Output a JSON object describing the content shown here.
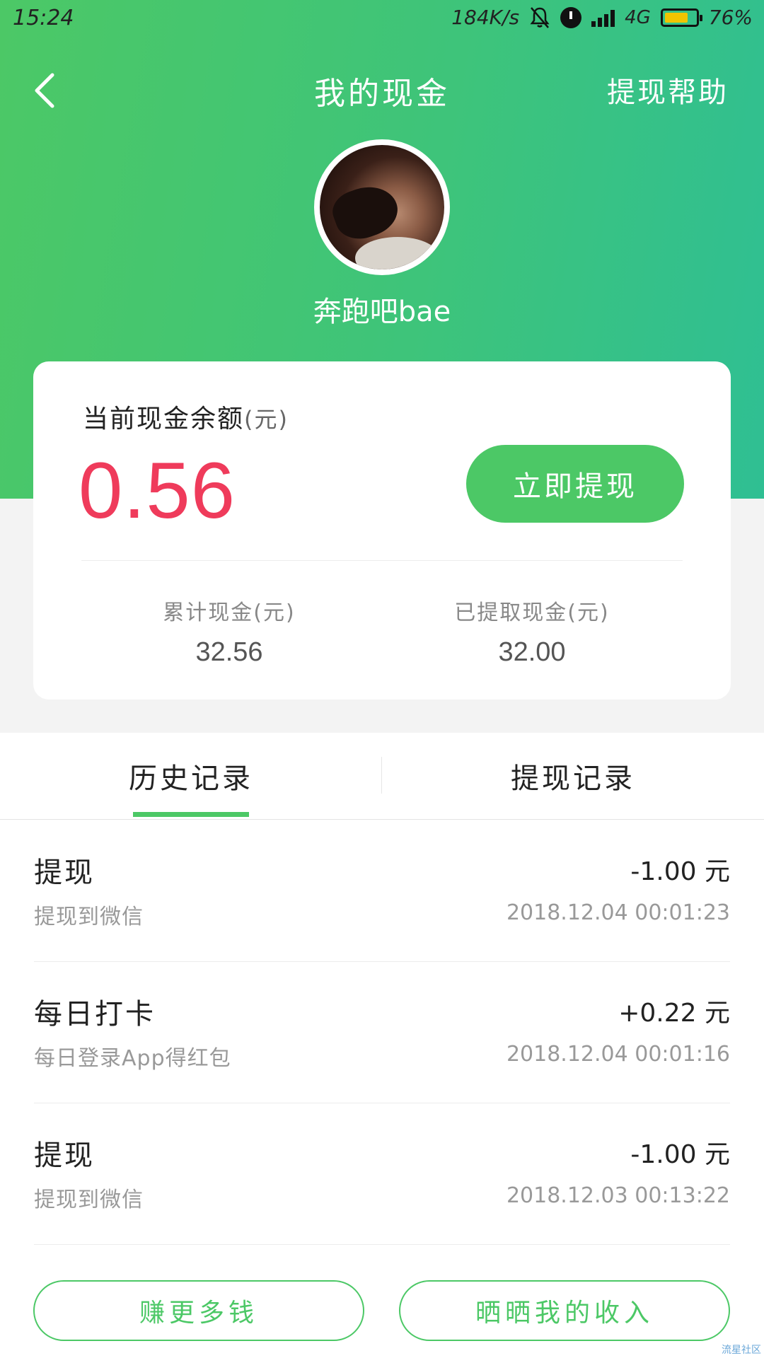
{
  "status_bar": {
    "time": "15:24",
    "network_speed": "184K/s",
    "network_type": "4G",
    "battery_percent": "76%",
    "battery_level": 0.76,
    "battery_color": "#f0c400",
    "icons": [
      "bell-off-icon",
      "alarm-icon",
      "signal-icon",
      "battery-icon"
    ]
  },
  "nav": {
    "title": "我的现金",
    "help_label": "提现帮助",
    "back_icon": "chevron-left-icon"
  },
  "profile": {
    "username": "奔跑吧bae"
  },
  "balance": {
    "label": "当前现金余额",
    "unit": "(元)",
    "value": "0.56",
    "withdraw_button": "立即提现",
    "total_label": "累计现金(元)",
    "total_value": "32.56",
    "withdrawn_label": "已提取现金(元)",
    "withdrawn_value": "32.00"
  },
  "tabs": [
    {
      "label": "历史记录",
      "active": true
    },
    {
      "label": "提现记录",
      "active": false
    }
  ],
  "records": [
    {
      "title": "提现",
      "desc": "提现到微信",
      "amount": "-1.00 元",
      "time": "2018.12.04 00:01:23"
    },
    {
      "title": "每日打卡",
      "desc": "每日登录App得红包",
      "amount": "+0.22 元",
      "time": "2018.12.04 00:01:16"
    },
    {
      "title": "提现",
      "desc": "提现到微信",
      "amount": "-1.00 元",
      "time": "2018.12.03 00:13:22"
    }
  ],
  "bottom": {
    "earn_more": "赚更多钱",
    "share_income": "晒晒我的收入"
  },
  "watermark": "流星社区",
  "colors": {
    "brand_green": "#4cc866",
    "balance_red": "#ef3b5b"
  }
}
